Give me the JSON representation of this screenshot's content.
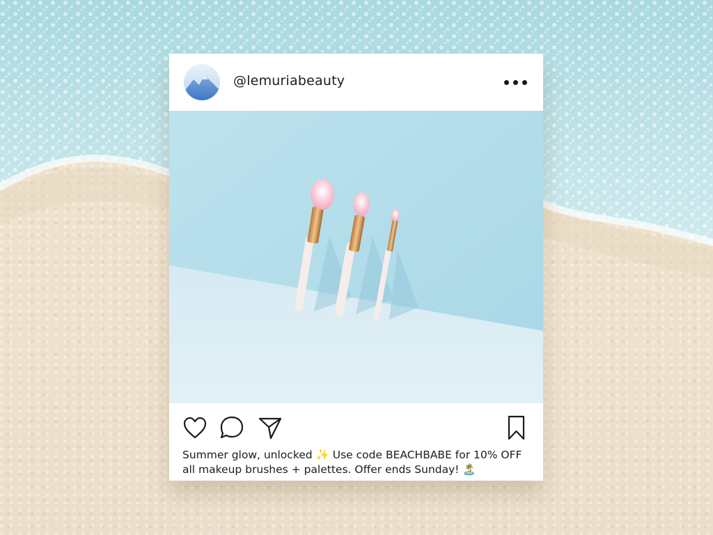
{
  "post": {
    "username": "@lemuriabeauty",
    "caption": "Summer glow, unlocked ✨ Use code BEACHBABE for 10% OFF all makeup brushes + palettes. Offer ends Sunday! 🏝️"
  },
  "icons": {
    "more": "more-options-icon",
    "like": "heart-icon",
    "comment": "comment-bubble-icon",
    "share": "paper-plane-icon",
    "save": "bookmark-icon"
  },
  "colors": {
    "card": "#ffffff",
    "text": "#1c1c1c",
    "sand": "#efe3cf",
    "sea": "#bfe3ea",
    "photo_wall": "#b4dde8",
    "photo_floor": "#d9ecf3"
  }
}
